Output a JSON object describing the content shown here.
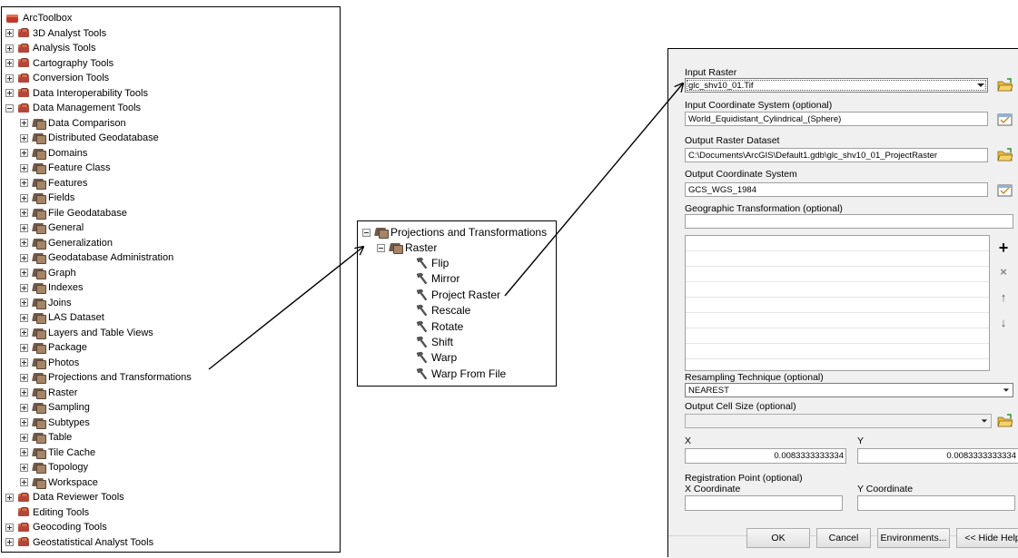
{
  "toolbox_panel": {
    "root_label": "ArcToolbox",
    "top_items": [
      {
        "label": "3D Analyst Tools"
      },
      {
        "label": "Analysis Tools"
      },
      {
        "label": "Cartography Tools"
      },
      {
        "label": "Conversion Tools"
      },
      {
        "label": "Data Interoperability Tools"
      },
      {
        "label": "Data Management Tools"
      }
    ],
    "dm_items": [
      {
        "label": "Data Comparison"
      },
      {
        "label": "Distributed Geodatabase"
      },
      {
        "label": "Domains"
      },
      {
        "label": "Feature Class"
      },
      {
        "label": "Features"
      },
      {
        "label": "Fields"
      },
      {
        "label": "File Geodatabase"
      },
      {
        "label": "General"
      },
      {
        "label": "Generalization"
      },
      {
        "label": "Geodatabase Administration"
      },
      {
        "label": "Graph"
      },
      {
        "label": "Indexes"
      },
      {
        "label": "Joins"
      },
      {
        "label": "LAS Dataset"
      },
      {
        "label": "Layers and Table Views"
      },
      {
        "label": "Package"
      },
      {
        "label": "Photos"
      },
      {
        "label": "Projections and Transformations"
      },
      {
        "label": "Raster"
      },
      {
        "label": "Sampling"
      },
      {
        "label": "Subtypes"
      },
      {
        "label": "Table"
      },
      {
        "label": "Tile Cache"
      },
      {
        "label": "Topology"
      },
      {
        "label": "Workspace"
      }
    ],
    "bottom_items": [
      {
        "label": "Data Reviewer Tools"
      },
      {
        "label": "Editing Tools"
      },
      {
        "label": "Geocoding Tools"
      },
      {
        "label": "Geostatistical Analyst Tools"
      }
    ]
  },
  "projections_panel": {
    "toolset_label": "Projections and Transformations",
    "raster_label": "Raster",
    "tools": [
      {
        "label": "Flip"
      },
      {
        "label": "Mirror"
      },
      {
        "label": "Project Raster"
      },
      {
        "label": "Rescale"
      },
      {
        "label": "Rotate"
      },
      {
        "label": "Shift"
      },
      {
        "label": "Warp"
      },
      {
        "label": "Warp From File"
      }
    ]
  },
  "dialog": {
    "input_raster_label": "Input Raster",
    "input_raster_value": "glc_shv10_01.Tif",
    "input_cs_label": "Input Coordinate System (optional)",
    "input_cs_value": "World_Equidistant_Cylindrical_(Sphere)",
    "output_raster_label": "Output Raster Dataset",
    "output_raster_value": "C:\\Documents\\ArcGIS\\Default1.gdb\\glc_shv10_01_ProjectRaster",
    "output_cs_label": "Output Coordinate System",
    "output_cs_value": "GCS_WGS_1984",
    "geo_transform_label": "Geographic Transformation (optional)",
    "geo_transform_value": "",
    "resampling_label": "Resampling Technique (optional)",
    "resampling_value": "NEAREST",
    "cell_size_label": "Output Cell Size (optional)",
    "cell_size_value": "",
    "x_label": "X",
    "x_value": "0.0083333333334",
    "y_label": "Y",
    "y_value": "0.0083333333334",
    "registration_label": "Registration Point (optional)",
    "x_coord_label": "X Coordinate",
    "y_coord_label": "Y Coordinate",
    "x_coord_value": "",
    "y_coord_value": "",
    "buttons": {
      "ok": "OK",
      "cancel": "Cancel",
      "environments": "Environments...",
      "hide_help": "<< Hide Help"
    }
  },
  "colors": {
    "toolbox_red": "#b3463a",
    "toolset_brown": "#6f5a4b",
    "dialog_bg": "#f0f0f0",
    "folder_yellow": "#e8b93c"
  }
}
